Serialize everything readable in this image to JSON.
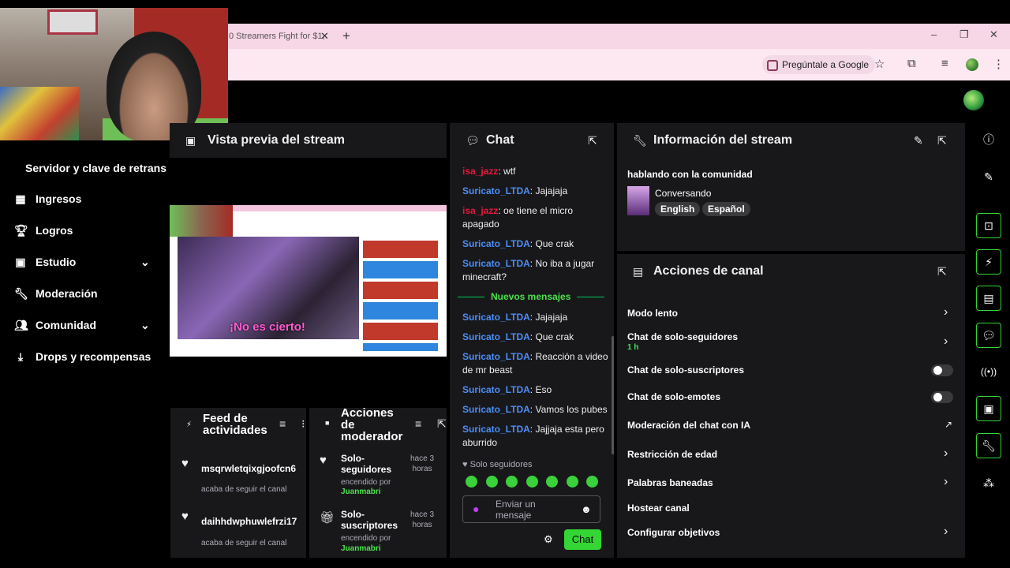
{
  "browser": {
    "tab_title": "0 Streamers Fight for $1,",
    "tab_close": "✕",
    "new_tab": "+",
    "window_controls": [
      "–",
      "❐",
      "✕"
    ],
    "ask_google": "Pregúntale a Google"
  },
  "sidebar": {
    "stream_key": "Servidor y clave de retransm",
    "items": [
      {
        "label": "Ingresos",
        "icon": "revenue-icon"
      },
      {
        "label": "Logros",
        "icon": "trophy-icon"
      },
      {
        "label": "Estudio",
        "icon": "studio-icon",
        "expandable": true
      },
      {
        "label": "Moderación",
        "icon": "wrench-icon"
      },
      {
        "label": "Comunidad",
        "icon": "community-icon",
        "expandable": true
      },
      {
        "label": "Drops y recompensas",
        "icon": "drops-icon"
      }
    ]
  },
  "preview": {
    "title": "Vista previa del stream",
    "caption": "¡No es cierto!"
  },
  "feed": {
    "title_line1": "Feed de",
    "title_line2": "actividades",
    "items": [
      {
        "user": "msqrwletqixgjoofcn6",
        "desc": "acaba de seguir el canal"
      },
      {
        "user": "daihhdwphuwlefrzi17",
        "desc": "acaba de seguir el canal"
      }
    ]
  },
  "mod_actions": {
    "title_line1": "Acciones",
    "title_line2": "de",
    "title_line3": "moderador",
    "items": [
      {
        "line1": "Solo-",
        "line2": "seguidores",
        "by": "encendido por",
        "mod": "Juanmabri",
        "time1": "hace 3",
        "time2": "horas"
      },
      {
        "line1": "Solo-",
        "line2": "suscriptores",
        "by": "encendido por",
        "mod": "Juanmabri",
        "time1": "hace 3",
        "time2": "horas"
      }
    ]
  },
  "chat": {
    "title": "Chat",
    "messages": [
      {
        "user": "isa_jazz",
        "color": "red",
        "text": "wtf"
      },
      {
        "user": "Suricato_LTDA",
        "color": "blue",
        "text": "Jajajaja"
      },
      {
        "user": "isa_jazz",
        "color": "red",
        "text": "oe tiene el micro apagado"
      },
      {
        "user": "Suricato_LTDA",
        "color": "blue",
        "text": "Que crak"
      },
      {
        "user": "Suricato_LTDA",
        "color": "blue",
        "text": "No iba a jugar minecraft?"
      }
    ],
    "new_messages_label": "Nuevos mensajes",
    "new_messages": [
      {
        "user": "Suricato_LTDA",
        "text": "Jajajaja"
      },
      {
        "user": "Suricato_LTDA",
        "text": "Que crak"
      },
      {
        "user": "Suricato_LTDA",
        "text": "Reacción a video de mr beast"
      },
      {
        "user": "Suricato_LTDA",
        "text": "Eso"
      },
      {
        "user": "Suricato_LTDA",
        "text": "Vamos los pubes"
      },
      {
        "user": "Suricato_LTDA",
        "text": "Jajjaja esta pero aburrido"
      }
    ],
    "followers_only": "Solo seguidores",
    "input_placeholder": "Enviar un mensaje",
    "send_button": "Chat"
  },
  "stream_info": {
    "title": "Información del stream",
    "stream_title": "hablando con la comunidad",
    "category": "Conversando",
    "tags": [
      "English",
      "Español"
    ]
  },
  "channel_actions": {
    "title": "Acciones de canal",
    "items": [
      {
        "label": "Modo lento",
        "control": "chevron"
      },
      {
        "label": "Chat de solo-seguidores",
        "sub": "1 h",
        "control": "chevron"
      },
      {
        "label": "Chat de solo-suscriptores",
        "control": "toggle",
        "on": false
      },
      {
        "label": "Chat de solo-emotes",
        "control": "toggle",
        "on": false
      },
      {
        "label": "Moderación del chat con IA",
        "control": "external"
      },
      {
        "label": "Restricción de edad",
        "control": "chevron"
      },
      {
        "label": "Palabras baneadas",
        "control": "chevron"
      },
      {
        "label": "Hostear canal",
        "control": "none"
      },
      {
        "label": "Configurar objetivos",
        "control": "chevron"
      }
    ]
  },
  "colors": {
    "accent": "#33d633",
    "panel": "#18181b",
    "user_blue": "#4c8ef5",
    "user_red": "#e8173b"
  }
}
